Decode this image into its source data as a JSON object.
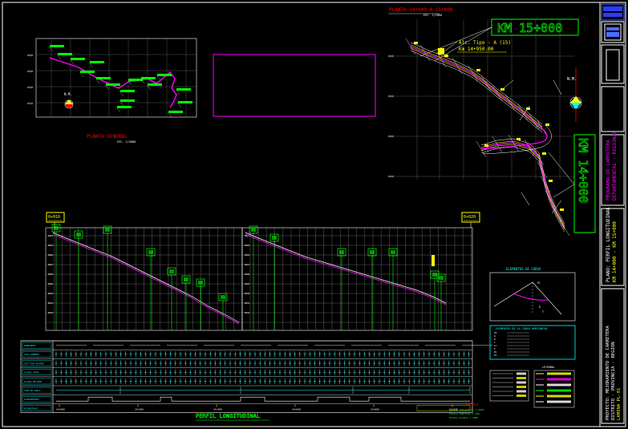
{
  "sheet": {
    "plan_general_title": "PLANTA GENERAL",
    "plan_general_scale": "ESC. 1/5000",
    "plan_detail_title": "PLANTA 14+000 A 15+000",
    "plan_detail_scale": "ESC. 1/2000",
    "km_top": "KM 15+000",
    "km_side": "KM 14+000",
    "callout_line1": "Alc. Tipo - A (15)",
    "callout_line2": "Km 14+950.00",
    "north_label": "N.M.",
    "station_left": "0+010",
    "station_right": "0+020",
    "profile_title": "PERFIL LONGITUDINAL",
    "curve_table_title": "ELEMENTOS DE LA CURVA HORIZONTAL",
    "curve_detail_title": "ELEMENTOS DE CURVA",
    "legend_title": "LEYENDA",
    "scale_title": "ESCALA",
    "scale_lines": [
      "ESCALA HORIZONTAL 1:2000",
      "ESCALA VERTICAL 1:200",
      "ESCALA PLANTA 1:2000"
    ],
    "title_block_lines": [
      "PLANO: PERFIL LONGITUDINAL",
      "PROYECTO: MEJORAMIENTO DE CARRETERA"
    ]
  },
  "profile_rows": [
    "PENDIENTE",
    "COTA TERRENO",
    "COTA SUB RASANTE",
    "ALTURA CORTE",
    "ALTURA RELLENO",
    "TIPO DE SUELO",
    "ALINEAMIENTO",
    "KILOMETRAJE"
  ],
  "progresivas": [
    "14+000",
    "14+200",
    "14+400",
    "14+600",
    "14+800",
    "15+000"
  ],
  "colors": {
    "cad_yellow": "#ffff00",
    "cad_green": "#00ff00",
    "cad_magenta": "#ff00ff",
    "cad_cyan": "#00ffff",
    "cad_red": "#ff0000",
    "cad_white": "#ffffff",
    "grid_gray": "#8a8a8a",
    "frame_blue": "#4a6cff"
  }
}
